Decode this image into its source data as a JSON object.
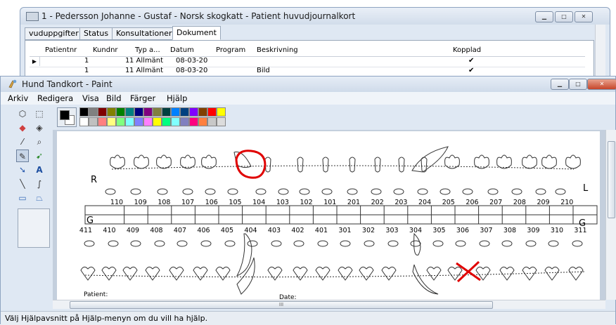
{
  "journal_window": {
    "title": "1 - Pedersson Johanne - Gustaf - Norsk skogkatt - Patient huvudjournalkort",
    "tabs": [
      {
        "label": "vuduppgifter",
        "active": false
      },
      {
        "label": "Status",
        "active": false
      },
      {
        "label": "Konsultationer",
        "active": false
      },
      {
        "label": "Dokument",
        "active": true
      }
    ],
    "columns": [
      "Patientnr",
      "Kundnr",
      "Typ a...",
      "Datum",
      "Program",
      "Beskrivning",
      "Kopplad"
    ],
    "rows": [
      {
        "patientnr": "1",
        "kundnr": "1",
        "typ": "1 Allmänt",
        "datum": "08-03-20",
        "program": "",
        "beskrivning": "",
        "kopplad": "✔"
      },
      {
        "patientnr": "1",
        "kundnr": "1",
        "typ": "1 Allmänt",
        "datum": "08-03-20",
        "program": "",
        "beskrivning": "Bild",
        "kopplad": "✔"
      }
    ]
  },
  "paint_window": {
    "title": "Hund Tandkort - Paint",
    "menu": [
      "Arkiv",
      "Redigera",
      "Visa",
      "Bild",
      "Färger",
      "Hjälp"
    ],
    "palette_top": [
      "#000000",
      "#808080",
      "#800000",
      "#808000",
      "#008000",
      "#008080",
      "#000080",
      "#800080",
      "#808040",
      "#004040",
      "#0080ff",
      "#004080",
      "#8000ff",
      "#804000",
      "#ff0000",
      "#ffff00"
    ],
    "palette_bottom": [
      "#ffffff",
      "#c0c0c0",
      "#ff8080",
      "#ffff80",
      "#80ff80",
      "#80ffff",
      "#8080ff",
      "#ff80ff",
      "#ffff00",
      "#00ff80",
      "#80ffff",
      "#8080c0",
      "#ff0080",
      "#ff8040",
      "#c8c8c8",
      "#dcdcdc"
    ],
    "status_text": "Välj Hjälpavsnitt på Hjälp-menyn om du vill ha hjälp.",
    "scrollbar_grip": "III"
  },
  "dental_chart": {
    "left_marker": "R",
    "right_marker": "L",
    "grid_letter_left": "G",
    "grid_letter_right": "G",
    "upper_numbers": [
      "110",
      "109",
      "108",
      "107",
      "106",
      "105",
      "104",
      "103",
      "102",
      "101",
      "201",
      "202",
      "203",
      "204",
      "205",
      "206",
      "207",
      "208",
      "209",
      "210"
    ],
    "lower_numbers": [
      "411",
      "410",
      "409",
      "408",
      "407",
      "406",
      "405",
      "404",
      "403",
      "402",
      "401",
      "301",
      "302",
      "303",
      "304",
      "305",
      "306",
      "307",
      "308",
      "309",
      "310",
      "311"
    ],
    "patient_label": "Patient:",
    "date_label": "Date:",
    "highlight_color": "#e00000"
  }
}
